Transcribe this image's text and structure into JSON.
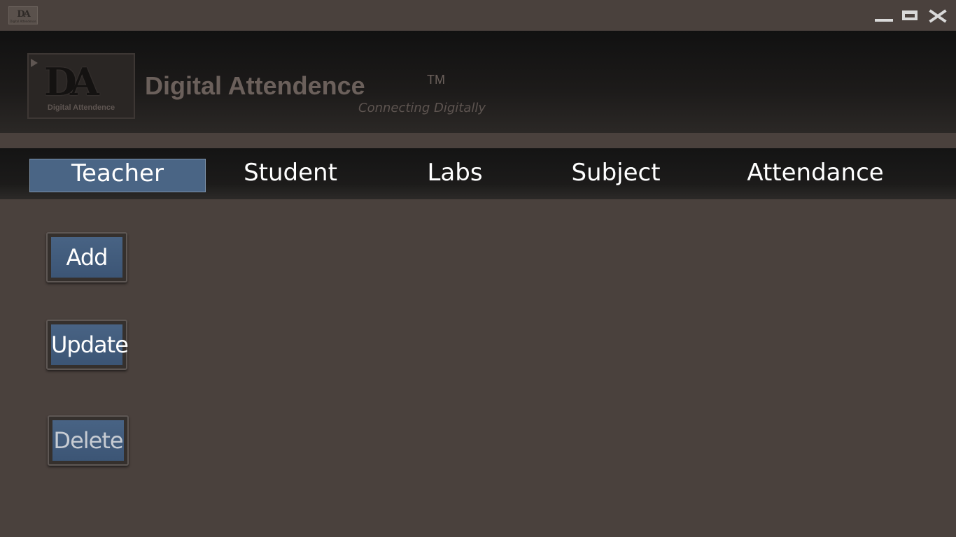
{
  "titlebar": {
    "icon_text": "DA",
    "icon_subtext": "Digital Attendence",
    "controls": [
      "minimize-icon",
      "maximize-icon",
      "close-icon"
    ]
  },
  "header": {
    "logo_letters": "DA",
    "logo_caption": "Digital Attendence",
    "brand": "Digital Attendence",
    "trademark": "TM",
    "tagline": "Connecting Digitally"
  },
  "nav": {
    "items": [
      {
        "label": "Teacher",
        "active": true
      },
      {
        "label": "Student"
      },
      {
        "label": "Labs"
      },
      {
        "label": "Subject"
      },
      {
        "label": "Attendance"
      }
    ]
  },
  "actions": {
    "add": "Add",
    "update": "Update",
    "delete": "Delete"
  },
  "colors": {
    "background": "#4a413d",
    "accent": "#4a6585",
    "banner": "#1a1918"
  }
}
